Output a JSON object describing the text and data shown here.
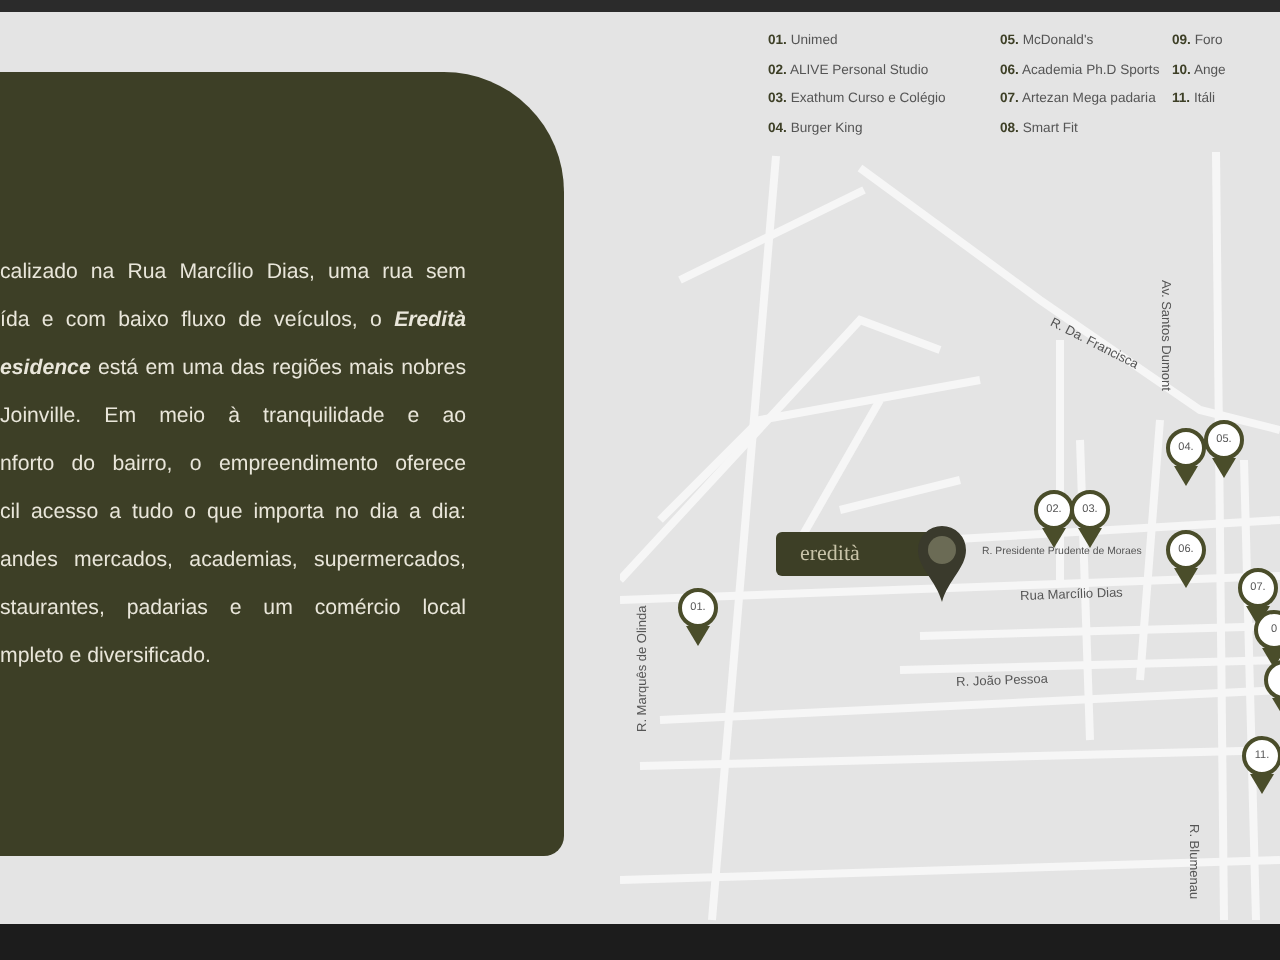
{
  "paragraph_lines": [
    "calizado na Rua Marcílio Dias, uma rua sem",
    "ída e com baixo fluxo de veículos, o **Eredità**",
    "**esidence** está em uma das regiões mais nobres",
    "Joinville. Em meio à tranquilidade e ao",
    "nforto do bairro, o empreendimento oferece",
    "cil acesso a tudo o que importa no dia a dia:",
    "andes mercados, academias, supermercados,",
    "staurantes, padarias e um comércio local",
    "mpleto e diversificado."
  ],
  "legend_columns": [
    [
      {
        "number": "01.",
        "name": "Unimed"
      },
      {
        "number": "02.",
        "name": "ALIVE Personal Studio"
      },
      {
        "number": "03.",
        "name": "Exathum Curso e Colégio"
      },
      {
        "number": "04.",
        "name": "Burger King"
      }
    ],
    [
      {
        "number": "05.",
        "name": "McDonald's"
      },
      {
        "number": "06.",
        "name": "Academia Ph.D Sports"
      },
      {
        "number": "07.",
        "name": "Artezan Mega padaria"
      },
      {
        "number": "08.",
        "name": "Smart Fit"
      }
    ],
    [
      {
        "number": "09.",
        "name": "Foro"
      },
      {
        "number": "10.",
        "name": "Ange"
      },
      {
        "number": "11.",
        "name": "Itáli"
      }
    ]
  ],
  "map": {
    "logo": "eredità",
    "streets": [
      {
        "name": "R. Da. Francisca",
        "kind": "diagonal"
      },
      {
        "name": "Av. Santos Dumont",
        "kind": "vertical-down"
      },
      {
        "name": "R. Presidente Prudente de Moraes",
        "kind": "small"
      },
      {
        "name": "Rua Marcílio Dias",
        "kind": "horizontal"
      },
      {
        "name": "R. João Pessoa",
        "kind": "horizontal"
      },
      {
        "name": "R. Marquês de Olinda",
        "kind": "vertical-up"
      },
      {
        "name": "R. Blumenau",
        "kind": "vertical-down"
      }
    ],
    "pins": [
      {
        "kind": "numbered",
        "label": "01."
      },
      {
        "kind": "numbered",
        "label": "02."
      },
      {
        "kind": "numbered",
        "label": "03."
      },
      {
        "kind": "numbered",
        "label": "04."
      },
      {
        "kind": "numbered",
        "label": "05."
      },
      {
        "kind": "numbered",
        "label": "06."
      },
      {
        "kind": "numbered",
        "label": "07."
      },
      {
        "kind": "numbered",
        "label": "0"
      },
      {
        "kind": "blank"
      },
      {
        "kind": "numbered",
        "label": "11."
      }
    ]
  }
}
